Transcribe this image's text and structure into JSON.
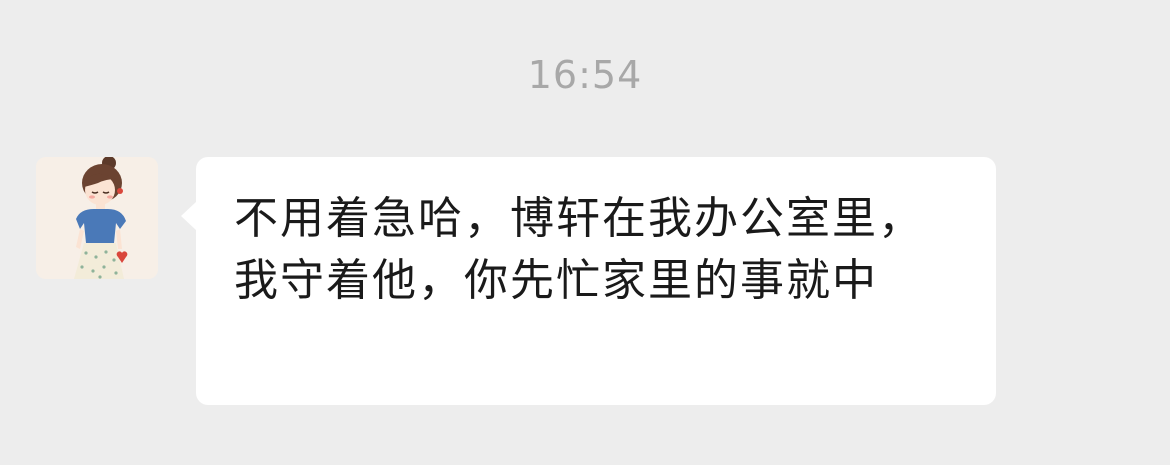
{
  "chat": {
    "timestamp": "16:54",
    "messages": [
      {
        "sender": "other",
        "avatar_icon": "cartoon-girl-avatar",
        "text": "不用着急哈，博轩在我办公室里，我守着他，你先忙家里的事就中"
      }
    ]
  },
  "colors": {
    "background": "#ededed",
    "bubble": "#ffffff",
    "timestamp_text": "#a8a8a8",
    "message_text": "#1a1a1a"
  }
}
